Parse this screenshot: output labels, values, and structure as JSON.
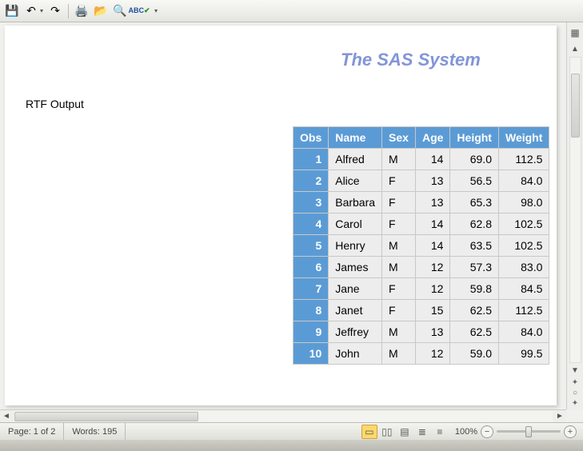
{
  "toolbar": {
    "save_title": "Save",
    "undo_title": "Undo",
    "redo_title": "Redo",
    "print_title": "Quick Print",
    "open_title": "Open",
    "preview_title": "Print Preview",
    "spell_title": "Spelling"
  },
  "doc": {
    "system_title": "The SAS System",
    "rtf_label": "RTF Output"
  },
  "table": {
    "headers": [
      "Obs",
      "Name",
      "Sex",
      "Age",
      "Height",
      "Weight"
    ],
    "rows": [
      {
        "obs": "1",
        "name": "Alfred",
        "sex": "M",
        "age": "14",
        "height": "69.0",
        "weight": "112.5"
      },
      {
        "obs": "2",
        "name": "Alice",
        "sex": "F",
        "age": "13",
        "height": "56.5",
        "weight": "84.0"
      },
      {
        "obs": "3",
        "name": "Barbara",
        "sex": "F",
        "age": "13",
        "height": "65.3",
        "weight": "98.0"
      },
      {
        "obs": "4",
        "name": "Carol",
        "sex": "F",
        "age": "14",
        "height": "62.8",
        "weight": "102.5"
      },
      {
        "obs": "5",
        "name": "Henry",
        "sex": "M",
        "age": "14",
        "height": "63.5",
        "weight": "102.5"
      },
      {
        "obs": "6",
        "name": "James",
        "sex": "M",
        "age": "12",
        "height": "57.3",
        "weight": "83.0"
      },
      {
        "obs": "7",
        "name": "Jane",
        "sex": "F",
        "age": "12",
        "height": "59.8",
        "weight": "84.5"
      },
      {
        "obs": "8",
        "name": "Janet",
        "sex": "F",
        "age": "15",
        "height": "62.5",
        "weight": "112.5"
      },
      {
        "obs": "9",
        "name": "Jeffrey",
        "sex": "M",
        "age": "13",
        "height": "62.5",
        "weight": "84.0"
      },
      {
        "obs": "10",
        "name": "John",
        "sex": "M",
        "age": "12",
        "height": "59.0",
        "weight": "99.5"
      }
    ]
  },
  "status": {
    "page_label": "Page: 1 of 2",
    "words_label": "Words: 195",
    "zoom_label": "100%"
  }
}
